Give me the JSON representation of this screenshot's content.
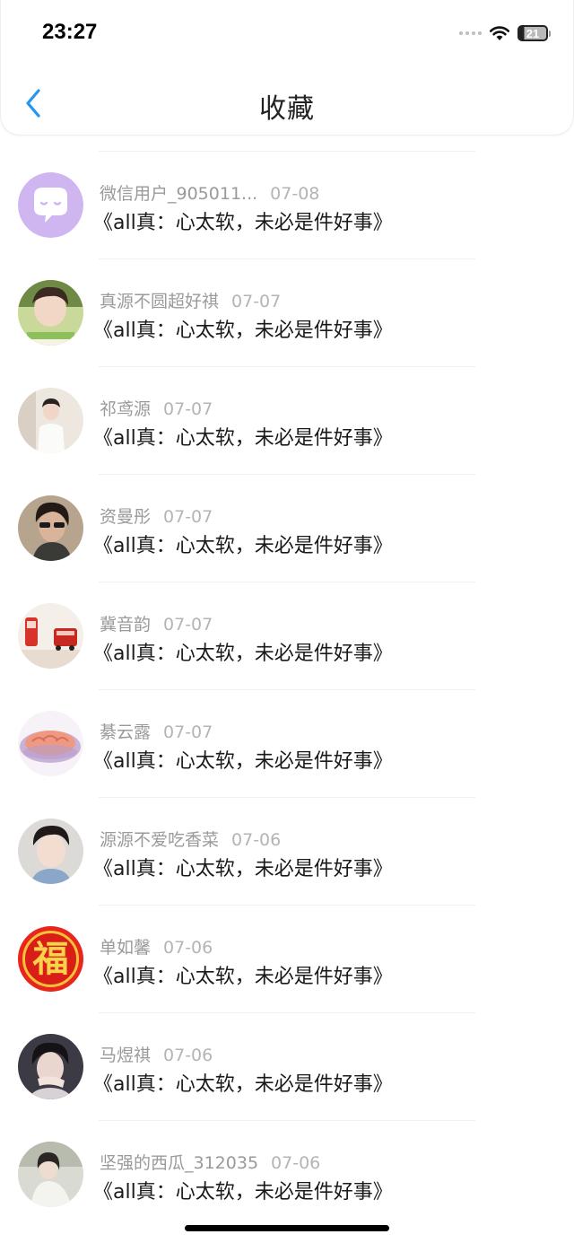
{
  "status_bar": {
    "time": "23:27",
    "battery": "21"
  },
  "nav": {
    "title": "收藏",
    "back_icon": "chevron-left-icon",
    "accent": "#2196F3"
  },
  "items": [
    {
      "username": "微信用户_905011...",
      "date": "07-08",
      "text": "《all真：心太软，未必是件好事》",
      "avatar": "wechat-default"
    },
    {
      "username": "真源不圆超好祺",
      "date": "07-07",
      "text": "《all真：心太软，未必是件好事》",
      "avatar": "photo"
    },
    {
      "username": "祁鸢源",
      "date": "07-07",
      "text": "《all真：心太软，未必是件好事》",
      "avatar": "photo"
    },
    {
      "username": "资曼彤",
      "date": "07-07",
      "text": "《all真：心太软，未必是件好事》",
      "avatar": "photo"
    },
    {
      "username": "冀音韵",
      "date": "07-07",
      "text": "《all真：心太软，未必是件好事》",
      "avatar": "photo"
    },
    {
      "username": "綦云露",
      "date": "07-07",
      "text": "《all真：心太软，未必是件好事》",
      "avatar": "photo"
    },
    {
      "username": "源源不爱吃香菜",
      "date": "07-06",
      "text": "《all真：心太软，未必是件好事》",
      "avatar": "photo"
    },
    {
      "username": "单如馨",
      "date": "07-06",
      "text": "《all真：心太软，未必是件好事》",
      "avatar": "fu-character"
    },
    {
      "username": "马煜祺",
      "date": "07-06",
      "text": "《all真：心太软，未必是件好事》",
      "avatar": "photo"
    },
    {
      "username": "坚强的西瓜_312035",
      "date": "07-06",
      "text": "《all真：心太软，未必是件好事》",
      "avatar": "photo"
    }
  ]
}
